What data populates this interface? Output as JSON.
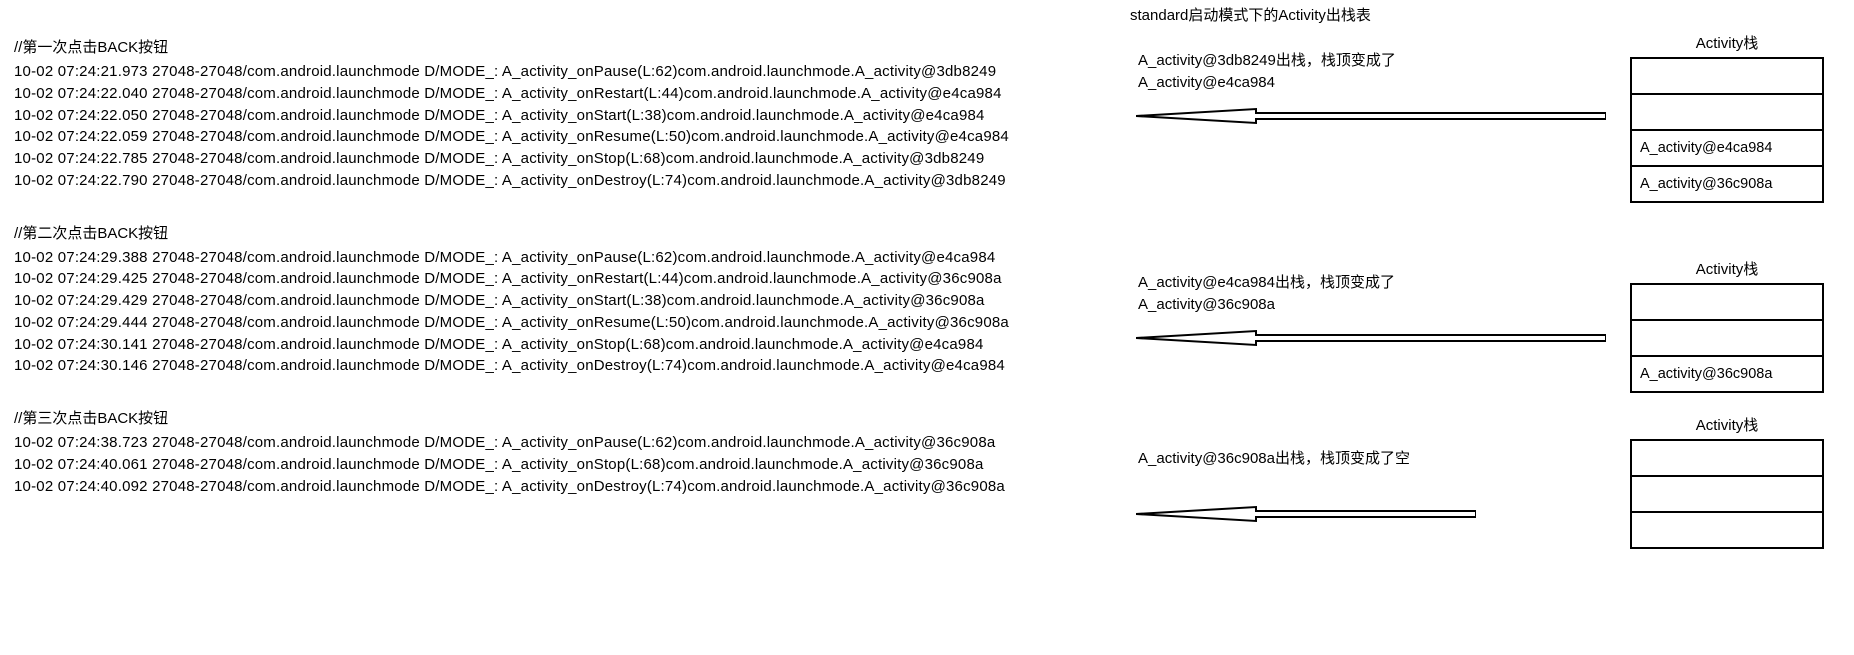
{
  "title": "standard启动模式下的Activity出栈表",
  "stack_label": "Activity栈",
  "sections": [
    {
      "comment": "//第一次点击BACK按钮",
      "annotation": "A_activity@3db8249出栈，栈顶变成了A_activity@e4ca984",
      "logs": [
        "10-02 07:24:21.973 27048-27048/com.android.launchmode D/MODE_: A_activity_onPause(L:62)com.android.launchmode.A_activity@3db8249",
        "10-02 07:24:22.040 27048-27048/com.android.launchmode D/MODE_: A_activity_onRestart(L:44)com.android.launchmode.A_activity@e4ca984",
        "10-02 07:24:22.050 27048-27048/com.android.launchmode D/MODE_: A_activity_onStart(L:38)com.android.launchmode.A_activity@e4ca984",
        "10-02 07:24:22.059 27048-27048/com.android.launchmode D/MODE_: A_activity_onResume(L:50)com.android.launchmode.A_activity@e4ca984",
        "10-02 07:24:22.785 27048-27048/com.android.launchmode D/MODE_: A_activity_onStop(L:68)com.android.launchmode.A_activity@3db8249",
        "10-02 07:24:22.790 27048-27048/com.android.launchmode D/MODE_: A_activity_onDestroy(L:74)com.android.launchmode.A_activity@3db8249"
      ],
      "stack": [
        "",
        "",
        "A_activity@e4ca984",
        "A_activity@36c908a"
      ]
    },
    {
      "comment": "//第二次点击BACK按钮",
      "annotation": "A_activity@e4ca984出栈，栈顶变成了A_activity@36c908a",
      "logs": [
        "10-02 07:24:29.388 27048-27048/com.android.launchmode D/MODE_: A_activity_onPause(L:62)com.android.launchmode.A_activity@e4ca984",
        "10-02 07:24:29.425 27048-27048/com.android.launchmode D/MODE_: A_activity_onRestart(L:44)com.android.launchmode.A_activity@36c908a",
        "10-02 07:24:29.429 27048-27048/com.android.launchmode D/MODE_: A_activity_onStart(L:38)com.android.launchmode.A_activity@36c908a",
        "10-02 07:24:29.444 27048-27048/com.android.launchmode D/MODE_: A_activity_onResume(L:50)com.android.launchmode.A_activity@36c908a",
        "10-02 07:24:30.141 27048-27048/com.android.launchmode D/MODE_: A_activity_onStop(L:68)com.android.launchmode.A_activity@e4ca984",
        "10-02 07:24:30.146 27048-27048/com.android.launchmode D/MODE_: A_activity_onDestroy(L:74)com.android.launchmode.A_activity@e4ca984"
      ],
      "stack": [
        "",
        "",
        "A_activity@36c908a"
      ]
    },
    {
      "comment": "//第三次点击BACK按钮",
      "annotation": "A_activity@36c908a出栈，栈顶变成了空",
      "logs": [
        "10-02 07:24:38.723 27048-27048/com.android.launchmode D/MODE_: A_activity_onPause(L:62)com.android.launchmode.A_activity@36c908a",
        "10-02 07:24:40.061 27048-27048/com.android.launchmode D/MODE_: A_activity_onStop(L:68)com.android.launchmode.A_activity@36c908a",
        "10-02 07:24:40.092 27048-27048/com.android.launchmode D/MODE_: A_activity_onDestroy(L:74)com.android.launchmode.A_activity@36c908a"
      ],
      "stack": [
        "",
        "",
        ""
      ]
    }
  ]
}
